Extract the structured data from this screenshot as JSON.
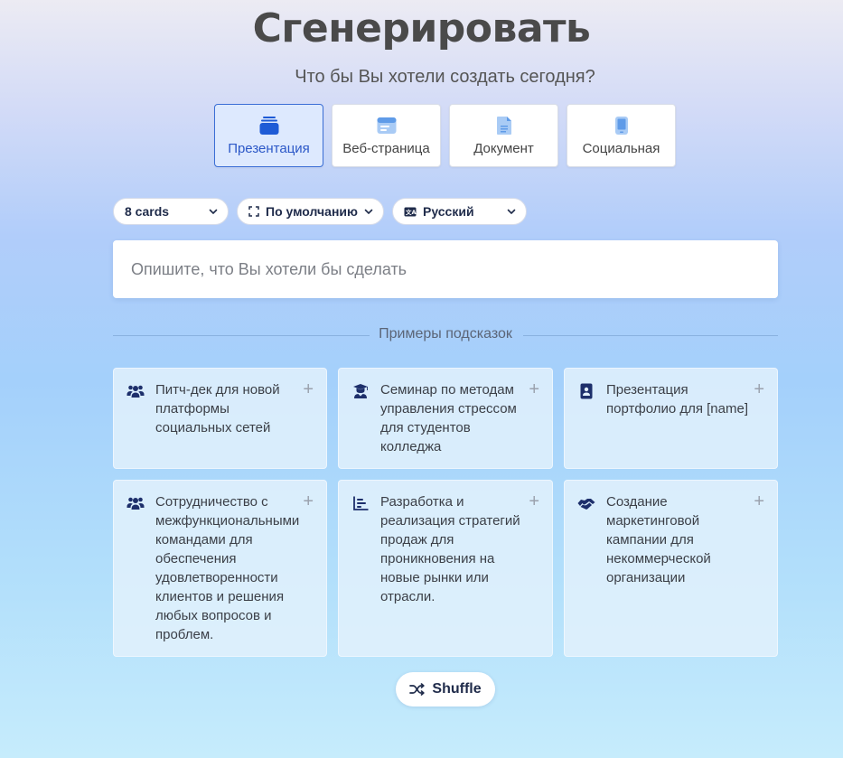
{
  "header": {
    "title": "Сгенерировать",
    "subtitle": "Что бы Вы хотели создать сегодня?"
  },
  "content_types": [
    {
      "label": "Презентация",
      "icon": "presentation-icon",
      "active": true
    },
    {
      "label": "Веб-страница",
      "icon": "webpage-icon",
      "active": false
    },
    {
      "label": "Документ",
      "icon": "document-icon",
      "active": false
    },
    {
      "label": "Социальная",
      "icon": "phone-icon",
      "active": false
    }
  ],
  "controls": {
    "cards": "8 cards",
    "format": "По умолчанию",
    "language": "Русский"
  },
  "prompt": {
    "placeholder": "Опишите, что Вы хотели бы сделать",
    "value": ""
  },
  "examples_heading": "Примеры подсказок",
  "examples": [
    {
      "text": "Питч-дек для новой платформы социальных сетей",
      "icon": "users-icon"
    },
    {
      "text": "Семинар по методам управления стрессом для студентов колледжа",
      "icon": "teacher-icon"
    },
    {
      "text": "Презентация портфолио для [name]",
      "icon": "id-badge-icon"
    },
    {
      "text": "Сотрудничество с межфункциональными командами для обеспечения удовлетворенности клиентов и решения любых вопросов и проблем.",
      "icon": "users-icon"
    },
    {
      "text": "Разработка и реализация стратегий продаж для проникновения на новые рынки или отрасли.",
      "icon": "bar-chart-icon"
    },
    {
      "text": "Создание маркетинговой кампании для некоммерческой организации",
      "icon": "handshake-icon"
    }
  ],
  "shuffle_label": "Shuffle",
  "colors": {
    "accent": "#2b57c7",
    "icon_blue": "#1e5bd6",
    "icon_light": "#a9cbf5",
    "icon_navy": "#1d2f6b"
  }
}
